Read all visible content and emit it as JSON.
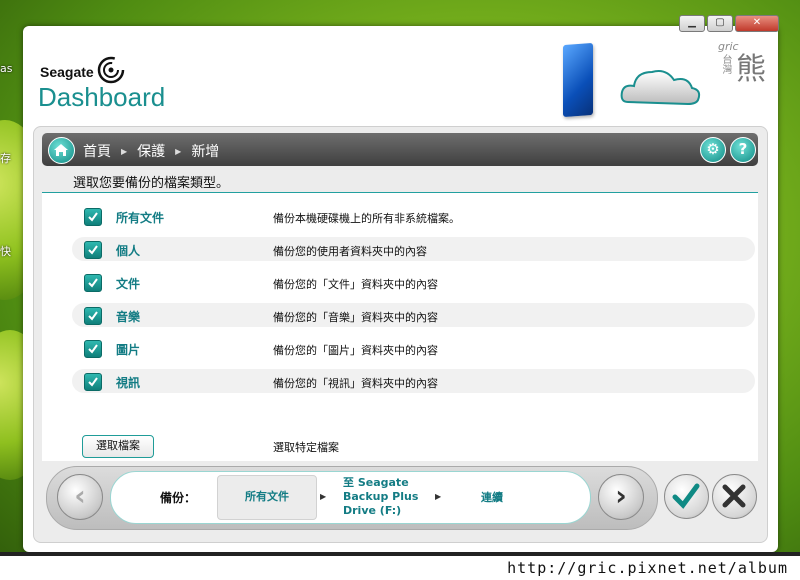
{
  "desktop": {
    "fragments": [
      "as",
      "存",
      "快"
    ]
  },
  "window": {
    "controls": [
      "minimize",
      "maximize",
      "close"
    ]
  },
  "brand": {
    "small": "Seagate",
    "big": "Dashboard"
  },
  "watermark_logo": {
    "script": "gric",
    "vertical": "台灣",
    "big": "熊"
  },
  "breadcrumb": [
    "首頁",
    "保護",
    "新增"
  ],
  "subtitle": "選取您要備份的檔案類型。",
  "file_types": [
    {
      "label": "所有文件",
      "desc": "備份本機硬碟機上的所有非系統檔案。",
      "checked": true
    },
    {
      "label": "個人",
      "desc": "備份您的使用者資料夾中的內容",
      "checked": true
    },
    {
      "label": "文件",
      "desc": "備份您的「文件」資料夾中的內容",
      "checked": true
    },
    {
      "label": "音樂",
      "desc": "備份您的「音樂」資料夾中的內容",
      "checked": true
    },
    {
      "label": "圖片",
      "desc": "備份您的「圖片」資料夾中的內容",
      "checked": true
    },
    {
      "label": "視訊",
      "desc": "備份您的「視訊」資料夾中的內容",
      "checked": true
    }
  ],
  "select_files": {
    "button": "選取檔案",
    "desc": "選取特定檔案"
  },
  "backup_bar": {
    "label": "備份：",
    "source": "所有文件",
    "dest_line1": "至 Seagate",
    "dest_line2": "Backup Plus",
    "dest_line3": "Drive (F:)",
    "schedule": "連續"
  },
  "colors": {
    "accent": "#137c84",
    "teal": "#1f9c98",
    "nav": "#4a4a4a"
  },
  "url_watermark": "http://gric.pixnet.net/album"
}
